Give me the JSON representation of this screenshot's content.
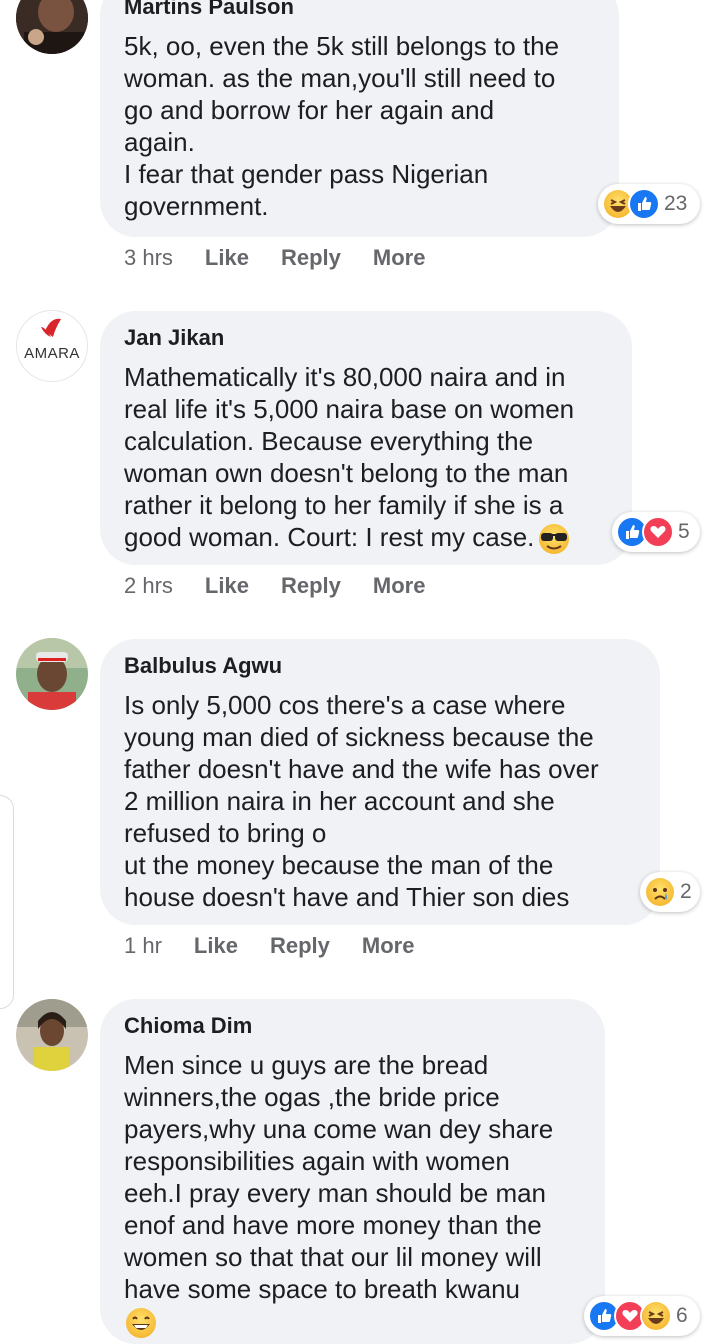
{
  "comments": [
    {
      "author": "Martins Paulson",
      "text": "5k, oo, even the 5k still belongs to the\nwoman. as the man,you'll still need to\ngo and borrow for her again and\nagain.\nI fear that gender pass Nigerian\ngovernment.",
      "time": "3 hrs",
      "reaction_count": "23",
      "reaction_icons": [
        "haha-icon",
        "like-icon"
      ]
    },
    {
      "author": "Jan Jikan",
      "avatar_text": "AMARA",
      "text": "Mathematically it's 80,000 naira and in\nreal life it's 5,000 naira base on women\ncalculation. Because everything the\nwoman own doesn't belong to the man\nrather it belong to her family if she is a\ngood woman. Court: I rest my case.",
      "time": "2 hrs",
      "reaction_count": "5",
      "reaction_icons": [
        "like-icon",
        "love-icon"
      ]
    },
    {
      "author": "Balbulus Agwu",
      "text": "Is only 5,000 cos there's a case where\nyoung man died of sickness because the\nfather doesn't have and the wife has over\n2 million naira in her account and she\nrefused to bring o\nut the money because the man of the\nhouse doesn't have and Thier son dies",
      "time": "1 hr",
      "reaction_count": "2",
      "reaction_icons": [
        "sad-icon"
      ]
    },
    {
      "author": "Chioma Dim",
      "text": "Men since u guys are the bread\nwinners,the ogas ,the bride price\npayers,why una come wan dey share\nresponsibilities again with women\neeh.I pray every man should be man\nenof and have more money than the\nwomen so that that our lil money will\nhave some space to breath kwanu",
      "reaction_count": "6",
      "reaction_icons": [
        "like-icon",
        "love-icon",
        "haha-icon"
      ]
    }
  ],
  "actions": {
    "like": "Like",
    "reply": "Reply",
    "more": "More"
  },
  "colors": {
    "bubble": "#f0f2f5",
    "like_blue": "#1877f2",
    "love_red": "#f33e58",
    "emoji_yellow": "#f7c93a",
    "meta_gray": "#65676b"
  }
}
